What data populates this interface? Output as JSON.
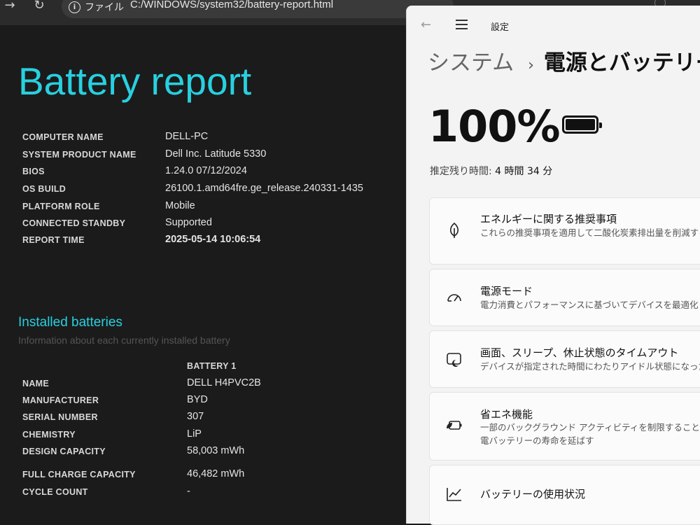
{
  "browser": {
    "site_chip_label": "ファイル",
    "url": "C:/WINDOWS/system32/battery-report.html"
  },
  "report": {
    "title": "Battery report",
    "system_info": [
      {
        "label": "COMPUTER NAME",
        "value": "DELL-PC"
      },
      {
        "label": "SYSTEM PRODUCT NAME",
        "value": "Dell Inc. Latitude 5330"
      },
      {
        "label": "BIOS",
        "value": "1.24.0 07/12/2024"
      },
      {
        "label": "OS BUILD",
        "value": "26100.1.amd64fre.ge_release.240331-1435"
      },
      {
        "label": "PLATFORM ROLE",
        "value": "Mobile"
      },
      {
        "label": "CONNECTED STANDBY",
        "value": "Supported"
      },
      {
        "label": "REPORT TIME",
        "value": "2025-05-14  10:06:54"
      }
    ],
    "installed_batteries": {
      "title": "Installed batteries",
      "subtitle": "Information about each currently installed battery",
      "column_header": "BATTERY 1",
      "rows": [
        {
          "label": "NAME",
          "value": "DELL H4PVC2B"
        },
        {
          "label": "MANUFACTURER",
          "value": "BYD"
        },
        {
          "label": "SERIAL NUMBER",
          "value": "307"
        },
        {
          "label": "CHEMISTRY",
          "value": "LiP"
        },
        {
          "label": "DESIGN CAPACITY",
          "value": "58,003 mWh"
        },
        {
          "label": "FULL CHARGE CAPACITY",
          "value": "46,482 mWh"
        },
        {
          "label": "CYCLE COUNT",
          "value": "-"
        }
      ]
    }
  },
  "settings": {
    "app_title": "設定",
    "breadcrumb_parent": "システム",
    "breadcrumb_separator": "›",
    "breadcrumb_current": "電源とバッテリー",
    "battery_percent": "100%",
    "battery_level": 1.0,
    "remaining_label": "推定残り時間:",
    "remaining_value": "4 時間 34 分",
    "cards": [
      {
        "icon": "leaf-icon",
        "title": "エネルギーに関する推奨事項",
        "desc": "これらの推奨事項を適用して二酸化炭素排出量を削減する"
      },
      {
        "icon": "gauge-icon",
        "title": "電源モード",
        "desc": "電力消費とパフォーマンスに基づいてデバイスを最適化"
      },
      {
        "icon": "screen-sleep-icon",
        "title": "画面、スリープ、休止状態のタイムアウト",
        "desc": "デバイスが指定された時間にわたりアイドル状態になった場"
      },
      {
        "icon": "battery-saver-icon",
        "title": "省エネ機能",
        "desc": "一部のバックグラウンド アクティビティを制限することで、電バッテリーの寿命を延ばす"
      },
      {
        "icon": "chart-line-icon",
        "title": "バッテリーの使用状況",
        "desc": ""
      }
    ]
  }
}
